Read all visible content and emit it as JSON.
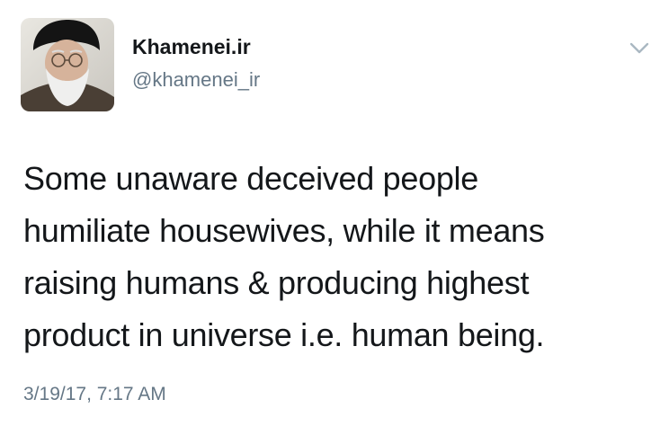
{
  "user": {
    "display_name": "Khamenei.ir",
    "handle": "@khamenei_ir"
  },
  "tweet": {
    "lines": [
      "Some unaware deceived people",
      "humiliate housewives, while it means",
      "raising humans & producing highest",
      "product in universe i.e. human being."
    ],
    "timestamp": "3/19/17, 7:17 AM"
  },
  "icons": {
    "menu": "chevron-down-icon",
    "avatar": "profile-photo"
  },
  "colors": {
    "text": "#14171a",
    "secondary": "#657786",
    "chevron": "#aab8c2"
  }
}
